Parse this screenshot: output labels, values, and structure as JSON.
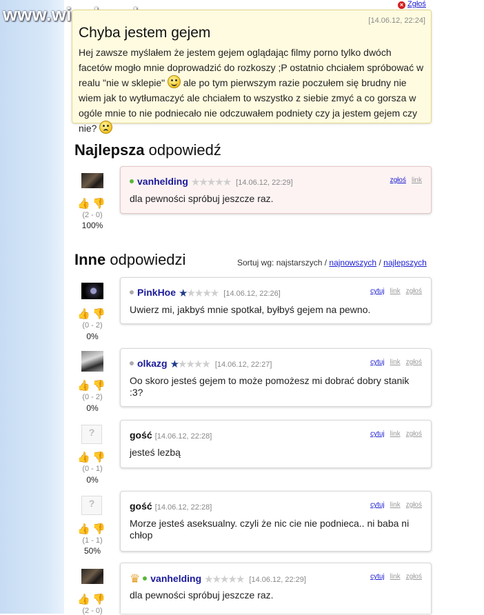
{
  "brand": "www.wiocha.pl",
  "report_top": "Zgłoś",
  "question": {
    "title": "Chyba jestem gejem",
    "date": "[14.06.12, 22:24]",
    "text_part1": "Hej zawsze myślałem że jestem gejem oglądając filmy porno tylko dwóch facetów mogło mnie doprowadzić do rozkoszy ;P ostatnio chciałem spróbować w realu \"nie w sklepie\"",
    "emoji1": "smile",
    "text_part2": "ale po tym pierwszym razie poczułem się brudny nie wiem jak to wytłumaczyć ale chciałem to wszystko z siebie zmyć a co gorsza w ogóle mnie to nie podniecało nie odczuwałem podniety czy ja jestem gejem czy nie?",
    "emoji2": "sad"
  },
  "best": {
    "heading_bold": "Najlepsza",
    "heading_rest": "odpowiedź",
    "user": "vanhelding",
    "online": true,
    "stars": 0,
    "date": "[14.06.12, 22:29]",
    "links": [
      "zgłoś",
      "link"
    ],
    "text": "dla pewności spróbuj jeszcze raz.",
    "score": "(2 - 0)",
    "percent": "100%"
  },
  "others": {
    "heading_bold": "Inne",
    "heading_rest": "odpowiedzi",
    "sort_label": "Sortuj wg: najstarszych /",
    "sort_options": [
      "najnowszych",
      "/",
      "najlepszych"
    ]
  },
  "answers": [
    {
      "user": "PinkHoe",
      "type": "user",
      "online": false,
      "stars": "half",
      "date": "[14.06.12, 22:26]",
      "text": "Uwierz mi, jakbyś mnie spotkał, byłbyś gejem na pewno.",
      "score": "(0 - 2)",
      "percent": "0%",
      "links": [
        "cytuj",
        "link",
        "zgłoś"
      ]
    },
    {
      "user": "olkazg",
      "type": "user",
      "online": false,
      "stars": "one",
      "date": "[14.06.12, 22:27]",
      "text": "Oo skoro jesteś gejem to może pomożesz mi dobrać dobry stanik :3?",
      "score": "(0 - 2)",
      "percent": "0%",
      "links": [
        "cytuj",
        "link",
        "zgłoś"
      ]
    },
    {
      "user": "gość",
      "type": "guest",
      "date": "[14.06.12, 22:28]",
      "text": "jesteś lezbą",
      "score": "(0 - 1)",
      "percent": "0%",
      "links": [
        "cytuj",
        "link",
        "zgłoś"
      ]
    },
    {
      "user": "gość",
      "type": "guest",
      "date": "[14.06.12, 22:28]",
      "text": "Morze jesteś aseksualny. czyli że nic cie nie podnieca.. ni baba ni chłop",
      "score": "(1 - 1)",
      "percent": "50%",
      "links": [
        "cytuj",
        "link",
        "zgłoś"
      ]
    },
    {
      "user": "vanhelding",
      "type": "user",
      "online": true,
      "crown": true,
      "stars": "none",
      "date": "[14.06.12, 22:29]",
      "text": "dla pewności spróbuj jeszcze raz.",
      "score": "(2 - 0)",
      "percent": "",
      "links": [
        "cytuj",
        "link",
        "zgłoś"
      ]
    }
  ],
  "colors": {
    "accent_link": "#1a1ad0",
    "question_bg": "#fffbe0",
    "best_bg": "#fdf3f3",
    "star": "#1f3b8a"
  }
}
